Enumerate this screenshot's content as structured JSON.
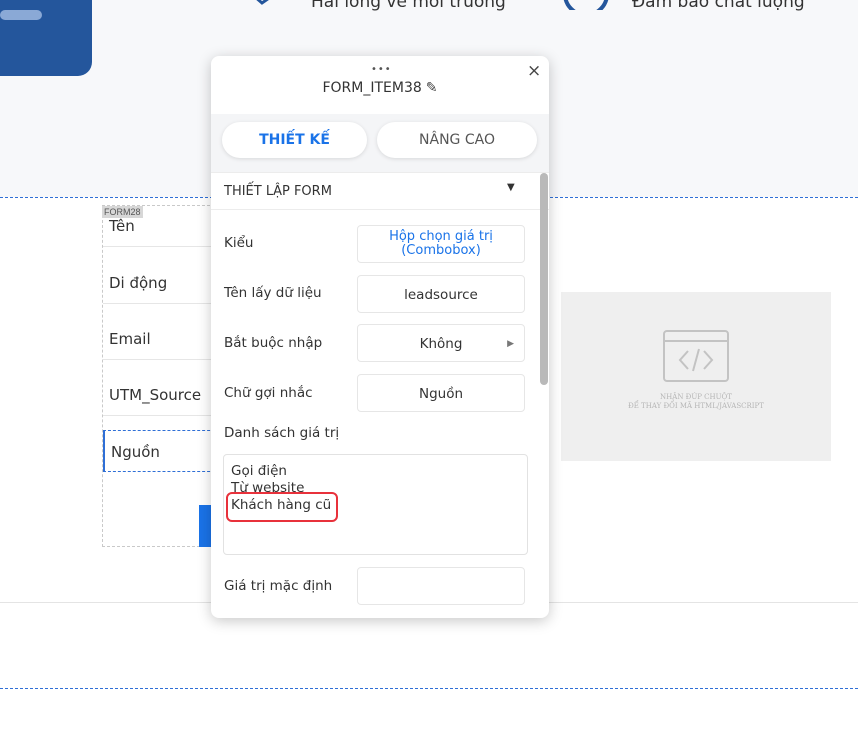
{
  "background": {
    "feature_1": "Hài lòng về môi trường",
    "feature_2": "Đảm bảo chất lượng"
  },
  "form": {
    "tag": "FORM28",
    "fields": [
      "Tên",
      "Di động",
      "Email",
      "UTM_Source",
      "Nguồn"
    ]
  },
  "html_widget": {
    "caption_1": "NHÂN ĐÚP CHUỘT",
    "caption_2": "ĐỂ THAY ĐỔI MÃ HTML/JAVASCRIPT"
  },
  "panel": {
    "drag_handle": "•••",
    "close": "×",
    "title": "FORM_ITEM38",
    "edit_icon": "✎",
    "tabs": {
      "design": "THIẾT KẾ",
      "advanced": "NÂNG CAO"
    },
    "section": {
      "title": "THIẾT LẬP FORM",
      "caret": "▼"
    },
    "rows": {
      "type_label": "Kiểu",
      "type_value_1": "Hộp chọn giá trị",
      "type_value_2": "(Combobox)",
      "field_name_label": "Tên lấy dữ liệu",
      "field_name_value": "leadsource",
      "required_label": "Bắt buộc nhập",
      "required_value": "Không",
      "required_arrow": "▶",
      "placeholder_label": "Chữ gợi nhắc",
      "placeholder_value": "Nguồn",
      "values_label": "Danh sách giá trị",
      "values": [
        "Gọi điện",
        "Từ website",
        "Khách hàng cũ"
      ],
      "default_label": "Giá trị mặc định",
      "default_value": ""
    }
  },
  "colors": {
    "accent": "#1a73e8",
    "highlight": "#e8313b",
    "logo": "#24569c"
  }
}
